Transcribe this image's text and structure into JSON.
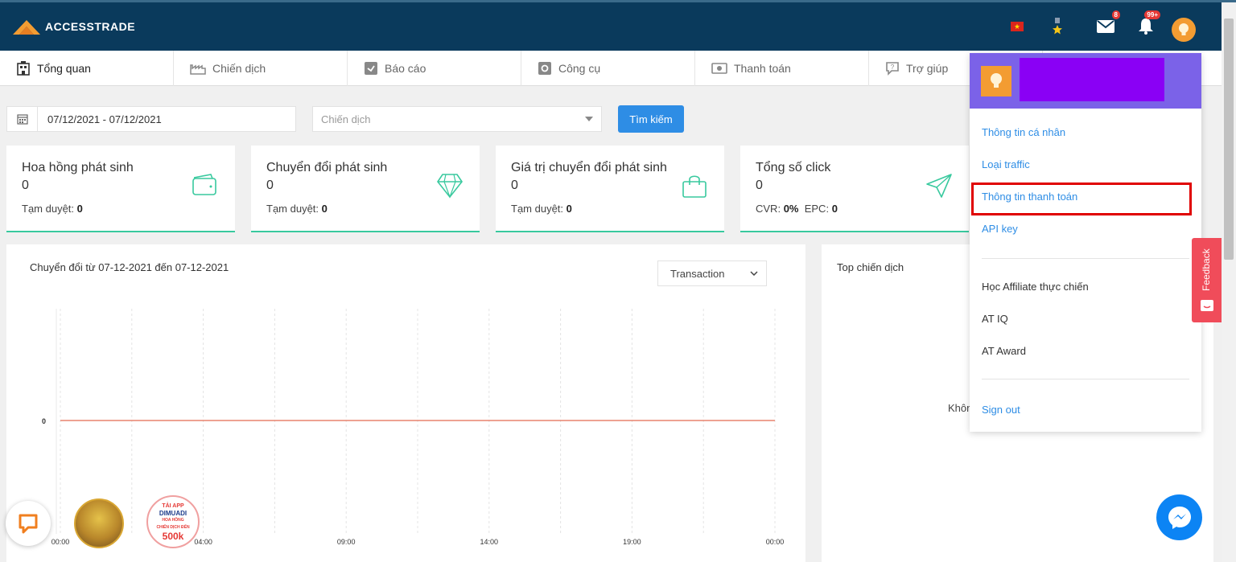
{
  "header": {
    "logo_text": "ACCESSTRADE",
    "mail_badge": "8",
    "bell_badge": "99+"
  },
  "nav": {
    "items": [
      {
        "label": "Tổng quan",
        "icon": "building-icon"
      },
      {
        "label": "Chiến dịch",
        "icon": "factory-icon"
      },
      {
        "label": "Báo cáo",
        "icon": "report-icon"
      },
      {
        "label": "Công cụ",
        "icon": "tools-icon"
      },
      {
        "label": "Thanh toán",
        "icon": "money-icon"
      },
      {
        "label": "Trợ giúp",
        "icon": "help-icon"
      }
    ]
  },
  "filters": {
    "date_range": "07/12/2021 - 07/12/2021",
    "campaign_placeholder": "Chiến dịch",
    "search_label": "Tìm kiếm"
  },
  "cards": [
    {
      "title": "Hoa hồng phát sinh",
      "value": "0",
      "sub_label": "Tạm duyệt:",
      "sub_value": "0",
      "icon": "wallet-icon"
    },
    {
      "title": "Chuyển đổi phát sinh",
      "value": "0",
      "sub_label": "Tạm duyệt:",
      "sub_value": "0",
      "icon": "diamond-icon"
    },
    {
      "title": "Giá trị chuyển đổi phát sinh",
      "value": "0",
      "sub_label": "Tạm duyệt:",
      "sub_value": "0",
      "icon": "shopping-bag-icon"
    },
    {
      "title": "Tổng số click",
      "value": "0",
      "cvr_label": "CVR:",
      "cvr_value": "0%",
      "epc_label": "EPC:",
      "epc_value": "0",
      "icon": "send-icon"
    }
  ],
  "chart_panel": {
    "title": "Chuyển đổi từ 07-12-2021 đến 07-12-2021",
    "metric_select": "Transaction"
  },
  "chart_data": {
    "type": "line",
    "x": [
      "00:00",
      "04:00",
      "09:00",
      "14:00",
      "19:00",
      "00:00"
    ],
    "series": [
      {
        "values": [
          0,
          0,
          0,
          0,
          0,
          0
        ]
      }
    ],
    "ytick_labels": [
      "0"
    ],
    "color": "#e8846f",
    "grid": true
  },
  "top_panel": {
    "title": "Top chiến dịch",
    "empty_text": "Khôn"
  },
  "dropdown": {
    "links": [
      "Thông tin cá nhân",
      "Loại traffic",
      "Thông tin thanh toán",
      "API key"
    ],
    "extras": [
      "Học Affiliate thực chiến",
      "AT IQ",
      "AT Award"
    ],
    "sign_out": "Sign out"
  },
  "feedback_label": "Feedback",
  "promo": {
    "line1": "TẢI APP",
    "line2": "DIMUADI",
    "line3": "HOA HỒNG",
    "line4": "CHIẾN DỊCH ĐẾN",
    "amount": "500k"
  },
  "colors": {
    "header_bg": "#0a3a5c",
    "accent_green": "#38c99e",
    "primary_blue": "#2e8de5",
    "dropdown_header": "#7b62e8",
    "highlight_red": "#e00000"
  }
}
